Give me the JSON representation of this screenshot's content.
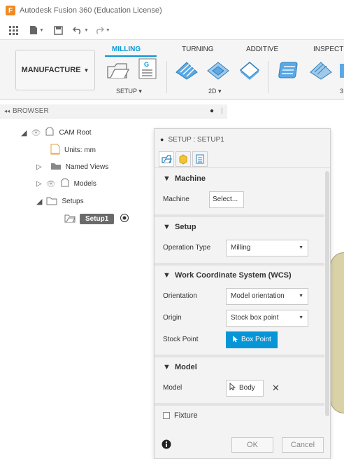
{
  "window": {
    "title": "Autodesk Fusion 360 (Education License)",
    "app_icon_letter": "F"
  },
  "qat": {
    "icons": [
      "grid-icon",
      "file-icon",
      "save-icon",
      "undo-icon",
      "redo-icon"
    ]
  },
  "ribbon": {
    "workspace": "MANUFACTURE",
    "tabs": [
      {
        "label": "MILLING",
        "active": true
      },
      {
        "label": "TURNING"
      },
      {
        "label": "ADDITIVE"
      },
      {
        "label": "INSPECTI"
      }
    ],
    "groups": {
      "setup": "SETUP",
      "two_d": "2D",
      "three_d": "3"
    }
  },
  "browser": {
    "header": "BROWSER",
    "items": [
      {
        "label": "CAM Root"
      },
      {
        "label": "Units: mm"
      },
      {
        "label": "Named Views"
      },
      {
        "label": "Models"
      },
      {
        "label": "Setups"
      },
      {
        "label": "Setup1",
        "selected": true
      }
    ]
  },
  "dialog": {
    "title": "SETUP : SETUP1",
    "sections": {
      "machine": {
        "title": "Machine",
        "label": "Machine",
        "button": "Select..."
      },
      "setup": {
        "title": "Setup",
        "op_type_label": "Operation Type",
        "op_type_value": "Milling"
      },
      "wcs": {
        "title": "Work Coordinate System (WCS)",
        "orientation_label": "Orientation",
        "orientation_value": "Model orientation",
        "origin_label": "Origin",
        "origin_value": "Stock box point",
        "stock_point_label": "Stock Point",
        "stock_point_value": "Box Point"
      },
      "model": {
        "title": "Model",
        "label": "Model",
        "value": "Body"
      },
      "fixture": {
        "title": "Fixture"
      }
    },
    "footer": {
      "ok": "OK",
      "cancel": "Cancel"
    }
  },
  "colors": {
    "accent": "#0696d7",
    "selected_bg": "#6a6a6a"
  }
}
